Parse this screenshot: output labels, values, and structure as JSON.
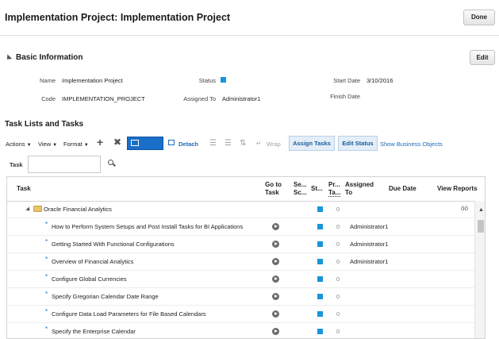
{
  "page": {
    "title": "Implementation Project: Implementation Project",
    "done_label": "Done"
  },
  "basic_info": {
    "title": "Basic Information",
    "edit_label": "Edit",
    "name_label": "Name",
    "name_value": "Implementation Project",
    "code_label": "Code",
    "code_value": "IMPLEMENTATION_PROJECT",
    "status_label": "Status",
    "assigned_label": "Assigned To",
    "assigned_value": "Administrator1",
    "start_label": "Start Date",
    "start_value": "3/10/2016",
    "finish_label": "Finish Date"
  },
  "tasks_section": {
    "title": "Task Lists and Tasks"
  },
  "toolbar": {
    "actions": "Actions",
    "view": "View",
    "format": "Format",
    "detach": "Detach",
    "wrap": "Wrap",
    "assign_tasks": "Assign Tasks",
    "edit_status": "Edit Status",
    "show_business_objects": "Show Business Objects"
  },
  "search": {
    "label": "Task",
    "value": ""
  },
  "table": {
    "headers": {
      "task": "Task",
      "goto_1": "Go to",
      "goto_2": "Task",
      "se_1": "Se...",
      "se_2": "Sc...",
      "st": "St...",
      "pr_1": "Pr...",
      "pr_2": "Ta...",
      "assigned_1": "Assigned",
      "assigned_2": "To",
      "due": "Due Date",
      "reports": "View Reports"
    },
    "parent_row": {
      "label": "Oracle Financial Analytics",
      "count": "0"
    },
    "rows": [
      {
        "task": "How to Perform System Setups and Post Install Tasks for BI Applications",
        "count": "0",
        "assigned": "Administrator1"
      },
      {
        "task": "Getting Started With Functional Configurations",
        "count": "0",
        "assigned": "Administrator1"
      },
      {
        "task": "Overview of Financial Analytics",
        "count": "0",
        "assigned": "Administrator1"
      },
      {
        "task": "Configure Global Currencies",
        "count": "0",
        "assigned": ""
      },
      {
        "task": "Specify Gregorian Calendar Date Range",
        "count": "0",
        "assigned": ""
      },
      {
        "task": "Configure Data Load Parameters for File Based Calendars",
        "count": "0",
        "assigned": ""
      },
      {
        "task": "Specify the Enterprise Calendar",
        "count": "0",
        "assigned": ""
      }
    ]
  },
  "colors": {
    "status_blue": "#1a95d8",
    "link_blue": "#1e6bb8",
    "folder_yellow": "#e8c36a"
  }
}
